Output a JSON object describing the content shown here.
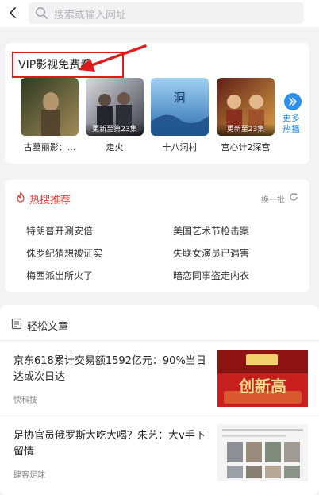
{
  "search": {
    "placeholder": "搜索或输入网址"
  },
  "vip": {
    "title": "VIP影视免费看",
    "posters": [
      {
        "title": "古墓丽影：...",
        "badge": "",
        "color1": "#3d4a2b",
        "color2": "#9a8a5c"
      },
      {
        "title": "走火",
        "badge": "更新至第23集",
        "color1": "#2e3442",
        "color2": "#7a7f8a"
      },
      {
        "title": "十八洞村",
        "badge": "",
        "color1": "#3b7fc4",
        "color2": "#b6d8f0"
      },
      {
        "title": "宫心计2深宫",
        "badge": "更新至23集",
        "color1": "#7a2c1c",
        "color2": "#d49a4a"
      }
    ],
    "more_label": "更多热播"
  },
  "hot": {
    "title": "热搜推荐",
    "refresh_label": "换一批",
    "items": [
      "特朗普开涮安倍",
      "美国艺术节枪击案",
      "侏罗纪猜想被证实",
      "失联女演员已遇害",
      "梅西派出所火了",
      "暗恋同事盗走内衣"
    ]
  },
  "articles": {
    "title": "轻松文章",
    "items": [
      {
        "title": "京东618累计交易额1592亿元：90%当日达或次日达",
        "source": "快科技",
        "thumb_text": "创新高"
      },
      {
        "title": "足协官员俄罗斯大吃大喝？朱艺：大v手下留情",
        "source": "肆客足球",
        "thumb_text": ""
      }
    ]
  },
  "colors": {
    "accent": "#2d8ff0",
    "hot": "#e0433a",
    "annotation": "#e01b1b"
  }
}
